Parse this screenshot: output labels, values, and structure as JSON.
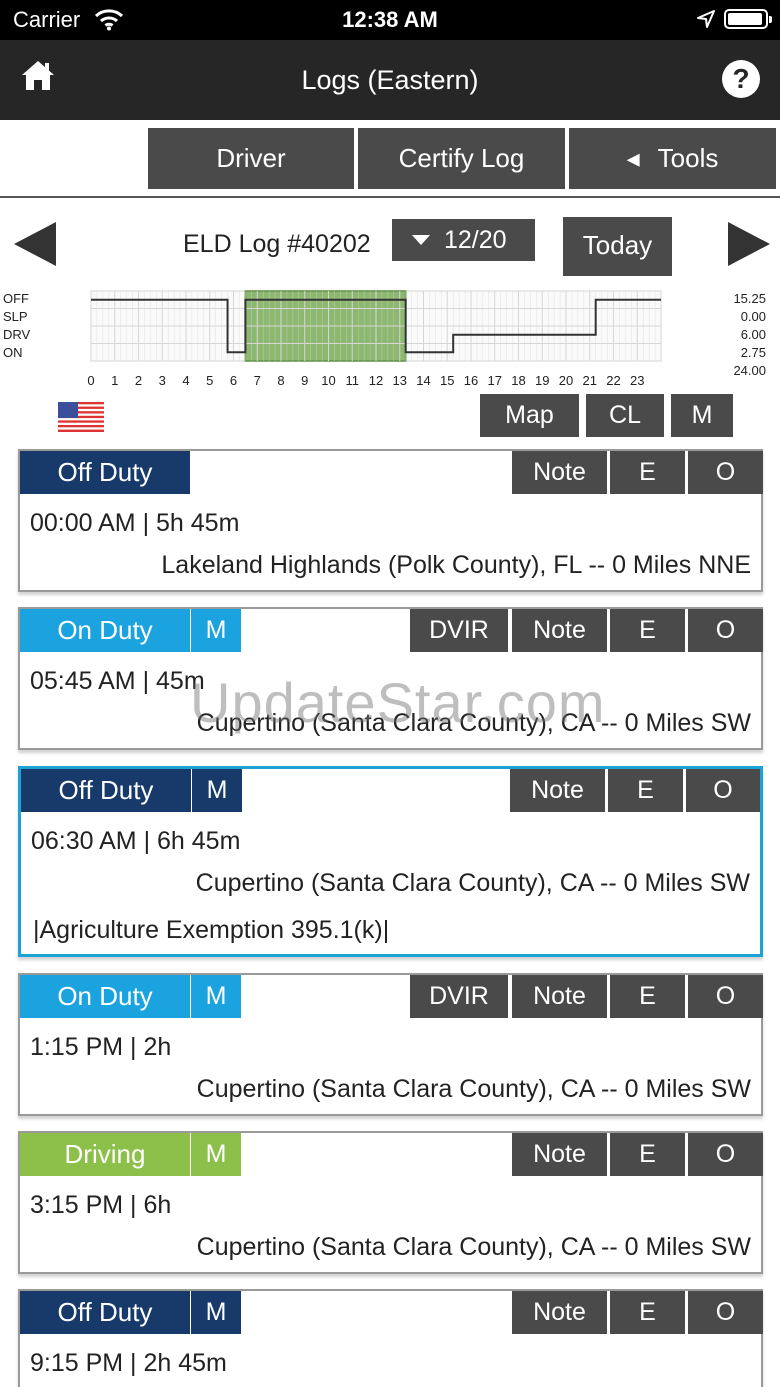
{
  "status_bar": {
    "carrier": "Carrier",
    "time": "12:38 AM"
  },
  "nav": {
    "title": "Logs (Eastern)",
    "help_glyph": "?"
  },
  "tabs": [
    {
      "label": "Driver"
    },
    {
      "label": "Certify Log"
    },
    {
      "label": "Tools",
      "glyph": "◂"
    }
  ],
  "log": {
    "number": "ELD Log #40202",
    "date": "12/20",
    "today_label": "Today"
  },
  "graph": {
    "status_labels": [
      "OFF",
      "SLP",
      "DRV",
      "ON"
    ],
    "totals": [
      "15.25",
      "0.00",
      "6.00",
      "2.75",
      "24.00"
    ],
    "hours": [
      "0",
      "1",
      "2",
      "3",
      "4",
      "5",
      "6",
      "7",
      "8",
      "9",
      "10",
      "11",
      "12",
      "13",
      "14",
      "15",
      "16",
      "17",
      "18",
      "19",
      "20",
      "21",
      "22",
      "23"
    ],
    "segments": [
      {
        "status": "OFF",
        "start": 0,
        "end": 5.75
      },
      {
        "status": "ON",
        "start": 5.75,
        "end": 6.5
      },
      {
        "status": "OFF",
        "start": 6.5,
        "end": 13.25
      },
      {
        "status": "ON",
        "start": 13.25,
        "end": 15.25
      },
      {
        "status": "DRV",
        "start": 15.25,
        "end": 21.25
      },
      {
        "status": "OFF",
        "start": 21.25,
        "end": 24
      }
    ],
    "highlight": {
      "start": 6.5,
      "end": 13.25
    },
    "colors": {
      "highlight": "#8db870",
      "line": "#333333",
      "grid": "#d6d6d6"
    }
  },
  "toolbar": {
    "map_label": "Map",
    "cl_label": "CL",
    "m_label": "M"
  },
  "events": [
    {
      "status": "Off Duty",
      "m": "",
      "time": "00:00 AM | 5h 45m",
      "location": "Lakeland Highlands (Polk County), FL -- 0 Miles NNE",
      "note": "",
      "dvir": "",
      "note_label": "Note",
      "e_label": "E",
      "o_label": "O"
    },
    {
      "status": "On Duty",
      "m": "M",
      "time": "05:45 AM | 45m",
      "location": "Cupertino (Santa Clara County), CA -- 0 Miles SW",
      "note": "",
      "dvir": "DVIR",
      "note_label": "Note",
      "e_label": "E",
      "o_label": "O"
    },
    {
      "status": "Off Duty",
      "m": "M",
      "time": "06:30 AM | 6h 45m",
      "location": "Cupertino (Santa Clara County), CA -- 0 Miles SW",
      "note": "|Agriculture Exemption 395.1(k)|",
      "dvir": "",
      "note_label": "Note",
      "e_label": "E",
      "o_label": "O"
    },
    {
      "status": "On Duty",
      "m": "M",
      "time": "1:15 PM | 2h",
      "location": "Cupertino (Santa Clara County), CA -- 0 Miles SW",
      "note": "",
      "dvir": "DVIR",
      "note_label": "Note",
      "e_label": "E",
      "o_label": "O"
    },
    {
      "status": "Driving",
      "m": "M",
      "time": "3:15 PM | 6h",
      "location": "Cupertino (Santa Clara County), CA -- 0 Miles SW",
      "note": "",
      "dvir": "",
      "note_label": "Note",
      "e_label": "E",
      "o_label": "O"
    },
    {
      "status": "Off Duty",
      "m": "M",
      "time": "9:15 PM | 2h 45m",
      "location": "",
      "note": "",
      "dvir": "",
      "note_label": "Note",
      "e_label": "E",
      "o_label": "O"
    }
  ],
  "watermark": "UpdateStar.com"
}
